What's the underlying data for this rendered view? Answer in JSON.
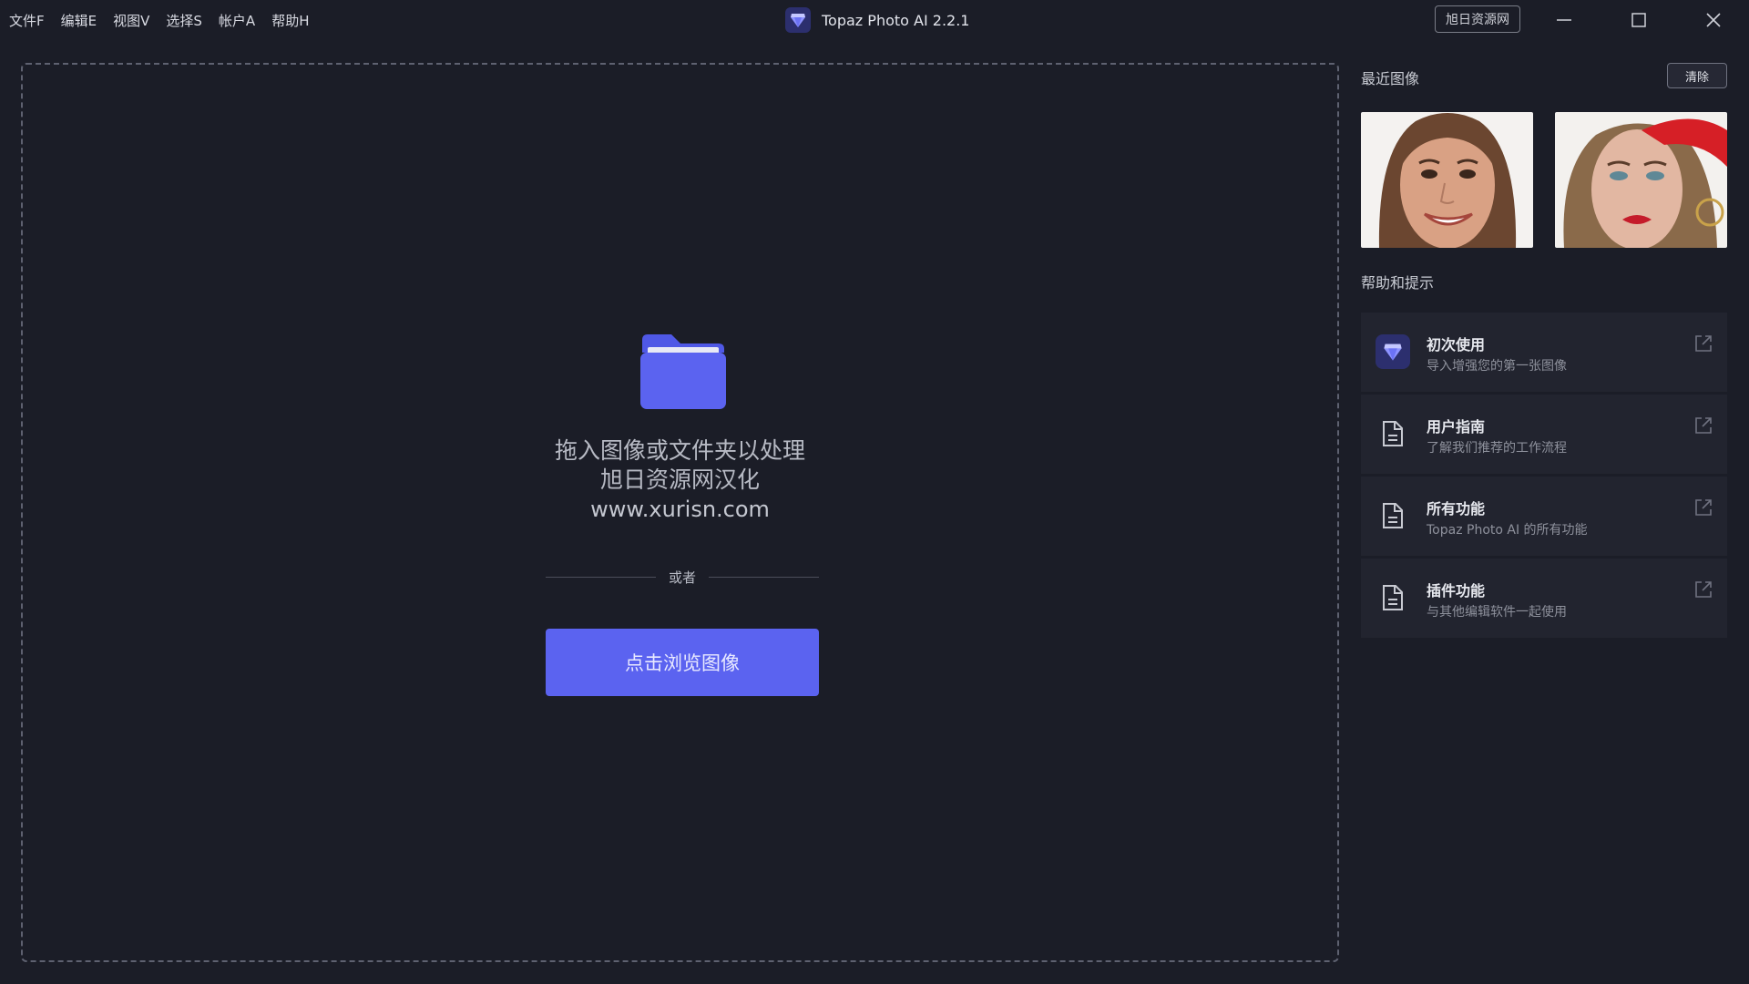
{
  "menu": [
    "文件F",
    "编辑E",
    "视图V",
    "选择S",
    "帐户A",
    "帮助H"
  ],
  "app": {
    "title": "Topaz Photo AI 2.2.1",
    "brand_box": "旭日资源网"
  },
  "dropzone": {
    "line1": "拖入图像或文件夹以处理",
    "line2": "旭日资源网汉化",
    "url": "www.xurisn.com",
    "or_text": "或者",
    "browse_label": "点击浏览图像"
  },
  "recent": {
    "label": "最近图像",
    "clear_label": "清除"
  },
  "help": {
    "label": "帮助和提示",
    "items": [
      {
        "title": "初次使用",
        "subtitle": "导入增强您的第一张图像",
        "icon": "topaz-logo-icon"
      },
      {
        "title": "用户指南",
        "subtitle": "了解我们推荐的工作流程",
        "icon": "document-icon"
      },
      {
        "title": "所有功能",
        "subtitle": "Topaz Photo AI 的所有功能",
        "icon": "document-icon"
      },
      {
        "title": "插件功能",
        "subtitle": "与其他编辑软件一起使用",
        "icon": "document-icon"
      }
    ]
  },
  "colors": {
    "accent": "#5b63f0",
    "background": "#1b1d27",
    "card": "#22242f"
  }
}
